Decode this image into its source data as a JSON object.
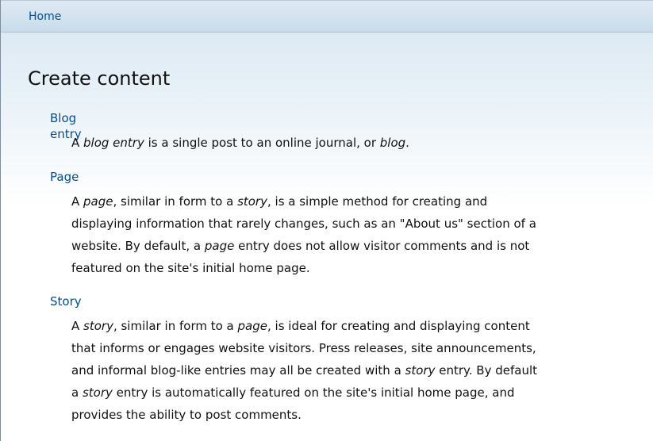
{
  "breadcrumb": {
    "home_label": "Home"
  },
  "page": {
    "title": "Create content"
  },
  "content_types": [
    {
      "name": "Blog entry",
      "description_lines": [
        [
          "A ",
          {
            "em": "blog entry"
          },
          " is a single post to an online journal, or ",
          {
            "em": "blog"
          },
          "."
        ]
      ]
    },
    {
      "name": "Page",
      "description_lines": [
        [
          "A ",
          {
            "em": "page"
          },
          ", similar in form to a ",
          {
            "em": "story"
          },
          ", is a simple method for creating and"
        ],
        [
          "displaying information that rarely changes, such as an \"About us\" section of a"
        ],
        [
          "website. By default, a ",
          {
            "em": "page"
          },
          " entry does not allow visitor comments and is not"
        ],
        [
          "featured on the site's initial home page."
        ]
      ]
    },
    {
      "name": "Story",
      "description_lines": [
        [
          "A ",
          {
            "em": "story"
          },
          ", similar in form to a ",
          {
            "em": "page"
          },
          ", is ideal for creating and displaying content"
        ],
        [
          "that informs or engages website visitors. Press releases, site announcements,"
        ],
        [
          "and informal blog-like entries may all be created with a ",
          {
            "em": "story"
          },
          " entry. By default"
        ],
        [
          "a ",
          {
            "em": "story"
          },
          " entry is automatically featured on the site's initial home page, and"
        ],
        [
          "provides the ability to post comments."
        ]
      ]
    }
  ]
}
